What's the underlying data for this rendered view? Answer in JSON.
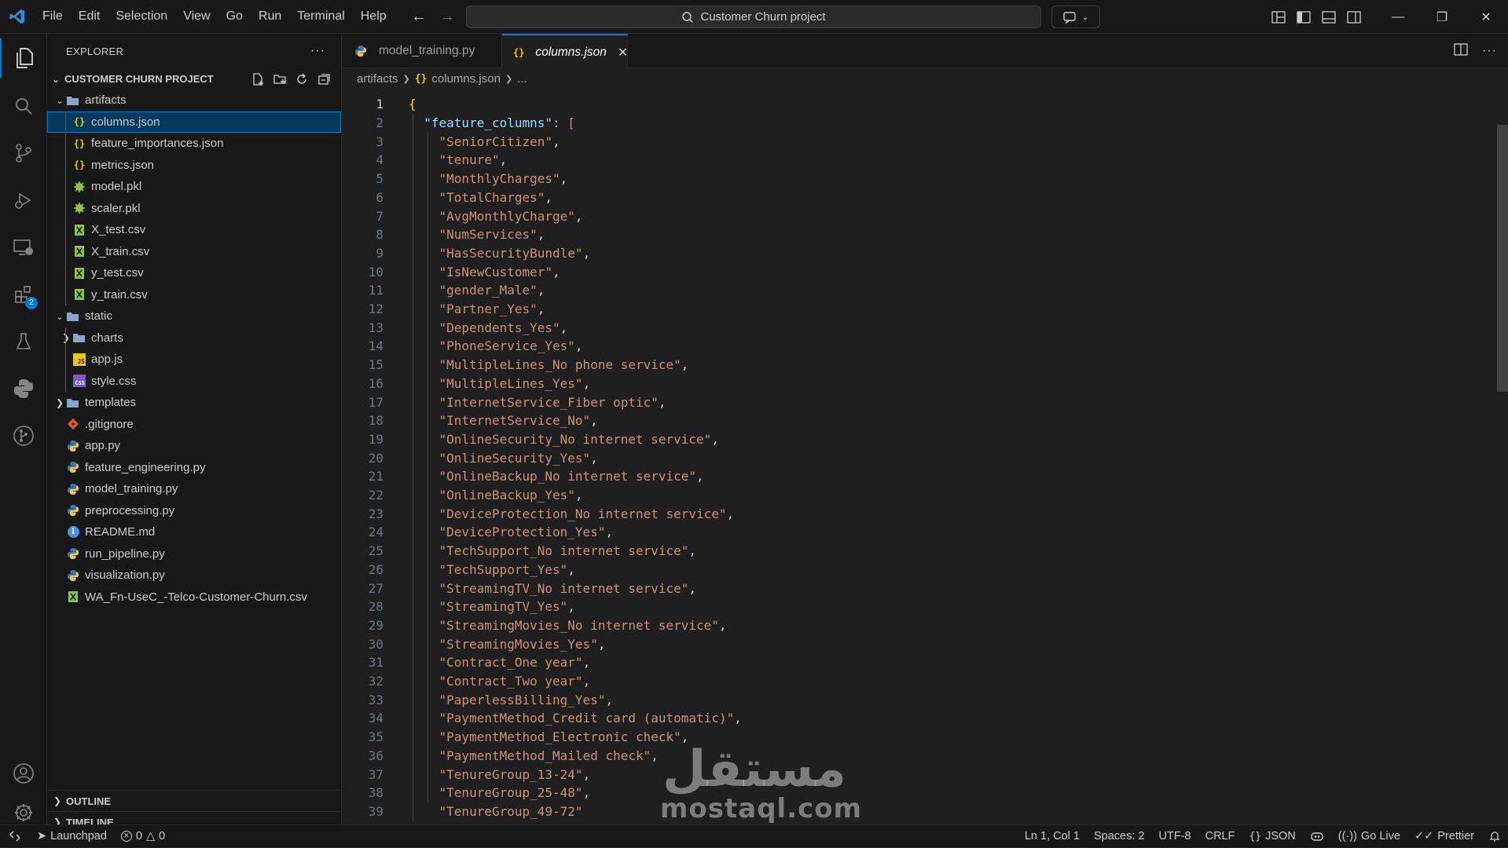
{
  "menu": [
    "File",
    "Edit",
    "Selection",
    "View",
    "Go",
    "Run",
    "Terminal",
    "Help"
  ],
  "search": {
    "text": "Customer Churn project"
  },
  "explorer": {
    "title": "EXPLORER",
    "project": "CUSTOMER CHURN PROJECT",
    "items": [
      {
        "label": "artifacts",
        "type": "folder-open",
        "indent": 0
      },
      {
        "label": "columns.json",
        "type": "json",
        "indent": 1,
        "selected": true
      },
      {
        "label": "feature_importances.json",
        "type": "json",
        "indent": 1
      },
      {
        "label": "metrics.json",
        "type": "json",
        "indent": 1
      },
      {
        "label": "model.pkl",
        "type": "pkl",
        "indent": 1
      },
      {
        "label": "scaler.pkl",
        "type": "pkl",
        "indent": 1
      },
      {
        "label": "X_test.csv",
        "type": "csv",
        "indent": 1
      },
      {
        "label": "X_train.csv",
        "type": "csv",
        "indent": 1
      },
      {
        "label": "y_test.csv",
        "type": "csv",
        "indent": 1
      },
      {
        "label": "y_train.csv",
        "type": "csv",
        "indent": 1
      },
      {
        "label": "static",
        "type": "folder-open",
        "indent": 0
      },
      {
        "label": "charts",
        "type": "folder",
        "indent": 1
      },
      {
        "label": "app.js",
        "type": "js",
        "indent": 1
      },
      {
        "label": "style.css",
        "type": "css",
        "indent": 1
      },
      {
        "label": "templates",
        "type": "folder",
        "indent": 0
      },
      {
        "label": ".gitignore",
        "type": "git",
        "indent": 0
      },
      {
        "label": "app.py",
        "type": "py",
        "indent": 0
      },
      {
        "label": "feature_engineering.py",
        "type": "py",
        "indent": 0
      },
      {
        "label": "model_training.py",
        "type": "py",
        "indent": 0
      },
      {
        "label": "preprocessing.py",
        "type": "py",
        "indent": 0
      },
      {
        "label": "README.md",
        "type": "md",
        "indent": 0
      },
      {
        "label": "run_pipeline.py",
        "type": "py",
        "indent": 0
      },
      {
        "label": "visualization.py",
        "type": "py",
        "indent": 0
      },
      {
        "label": "WA_Fn-UseC_-Telco-Customer-Churn.csv",
        "type": "csv",
        "indent": 0
      }
    ],
    "outline": "OUTLINE",
    "timeline": "TIMELINE"
  },
  "activity_badge": "2",
  "tabs": [
    {
      "label": "model_training.py",
      "active": false
    },
    {
      "label": "columns.json",
      "active": true
    }
  ],
  "breadcrumb": {
    "folder": "artifacts",
    "file": "columns.json",
    "more": "..."
  },
  "code": {
    "key": "\"feature_columns\"",
    "values": [
      "SeniorCitizen",
      "tenure",
      "MonthlyCharges",
      "TotalCharges",
      "AvgMonthlyCharge",
      "NumServices",
      "HasSecurityBundle",
      "IsNewCustomer",
      "gender_Male",
      "Partner_Yes",
      "Dependents_Yes",
      "PhoneService_Yes",
      "MultipleLines_No phone service",
      "MultipleLines_Yes",
      "InternetService_Fiber optic",
      "InternetService_No",
      "OnlineSecurity_No internet service",
      "OnlineSecurity_Yes",
      "OnlineBackup_No internet service",
      "OnlineBackup_Yes",
      "DeviceProtection_No internet service",
      "DeviceProtection_Yes",
      "TechSupport_No internet service",
      "TechSupport_Yes",
      "StreamingTV_No internet service",
      "StreamingTV_Yes",
      "StreamingMovies_No internet service",
      "StreamingMovies_Yes",
      "Contract_One year",
      "Contract_Two year",
      "PaperlessBilling_Yes",
      "PaymentMethod_Credit card (automatic)",
      "PaymentMethod_Electronic check",
      "PaymentMethod_Mailed check",
      "TenureGroup_13-24",
      "TenureGroup_25-48",
      "TenureGroup_49-72"
    ]
  },
  "status": {
    "launchpad": "Launchpad",
    "errors": "0",
    "warnings": "0",
    "position": "Ln 1, Col 1",
    "spaces": "Spaces: 2",
    "encoding": "UTF-8",
    "eol": "CRLF",
    "language": "JSON",
    "golive": "Go Live",
    "prettier": "Prettier"
  },
  "watermark": {
    "arabic": "مستقل",
    "latin": "mostaql.com"
  }
}
